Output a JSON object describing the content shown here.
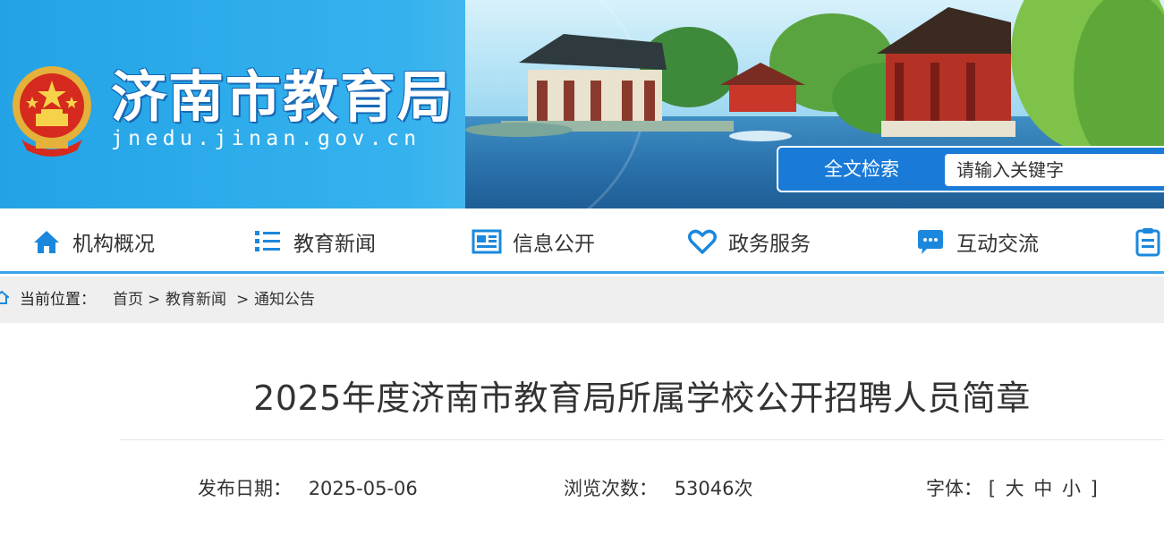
{
  "site": {
    "title": "济南市教育局",
    "domain": "jnedu.jinan.gov.cn"
  },
  "search": {
    "label": "全文检索",
    "placeholder": "请输入关键字"
  },
  "nav": {
    "items": [
      {
        "label": "机构概况",
        "icon": "home-icon"
      },
      {
        "label": "教育新闻",
        "icon": "list-icon"
      },
      {
        "label": "信息公开",
        "icon": "newspaper-icon"
      },
      {
        "label": "政务服务",
        "icon": "heart-icon"
      },
      {
        "label": "互动交流",
        "icon": "chat-icon"
      },
      {
        "label": "",
        "icon": "clipboard-icon"
      }
    ]
  },
  "breadcrumb": {
    "prefix": "当前位置：",
    "items": [
      "首页",
      "教育新闻",
      "通知公告"
    ],
    "separator": ">"
  },
  "article": {
    "title": "2025年度济南市教育局所属学校公开招聘人员简章",
    "publish_label": "发布日期：",
    "publish_date": "2025-05-06",
    "views_label": "浏览次数：",
    "views": "53046次",
    "font_label": "字体：",
    "font_open": "[",
    "font_large": "大",
    "font_medium": "中",
    "font_small": "小",
    "font_close": "]"
  },
  "colors": {
    "accent": "#1a7ad8",
    "nav_border": "#3aa2ea",
    "nav_icon": "#1b88dd"
  }
}
